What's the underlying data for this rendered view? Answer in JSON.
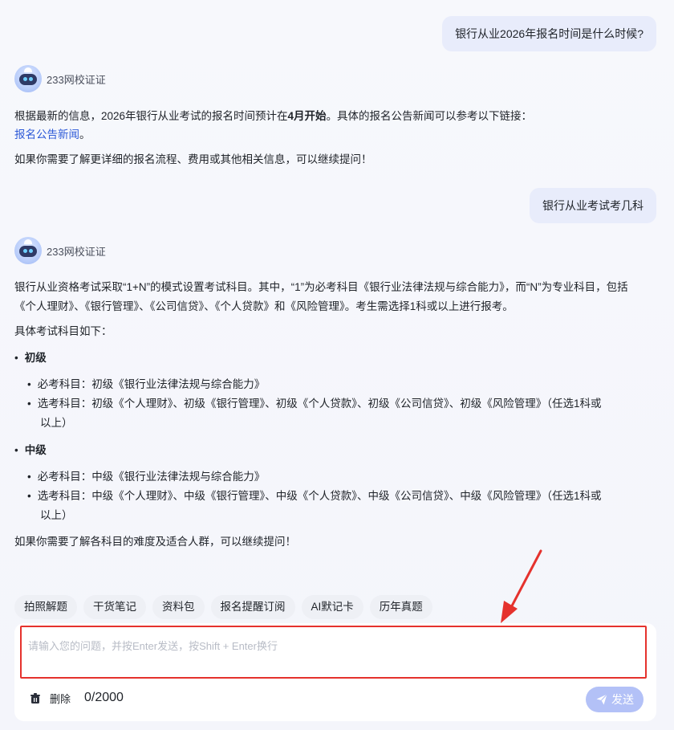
{
  "conversation": {
    "user_msg_1": "银行从业2026年报名时间是什么时候?",
    "user_msg_2": "银行从业考试考几科",
    "bot_name": "233网校证证",
    "answer_1": {
      "p1_prefix": "根据最新的信息，2026年银行从业考试的报名时间预计在",
      "p1_bold": "4月开始",
      "p1_suffix": "。具体的报名公告新闻可以参考以下链接：",
      "link_text": "报名公告新闻",
      "link_tail": "。",
      "p2": "如果你需要了解更详细的报名流程、费用或其他相关信息，可以继续提问！"
    },
    "answer_2": {
      "p1_line1": "银行从业资格考试采取“1+N”的模式设置考试科目。其中，“1”为必考科目《银行业法律法规与综合能力》，而“N”为专业科目，包括",
      "p1_line2": "《个人理财》、《银行管理》、《公司信贷》、《个人贷款》和《风险管理》。考生需选择1科或以上进行报考。",
      "intro": "具体考试科目如下：",
      "levels": [
        {
          "name": "初级",
          "required": "必考科目：初级《银行业法律法规与综合能力》",
          "optional_line1": "选考科目：初级《个人理财》、初级《银行管理》、初级《个人贷款》、初级《公司信贷》、初级《风险管理》（任选1科或",
          "optional_line2": "以上）"
        },
        {
          "name": "中级",
          "required": "必考科目：中级《银行业法律法规与综合能力》",
          "optional_line1": "选考科目：中级《个人理财》、中级《银行管理》、中级《个人贷款》、中级《公司信贷》、中级《风险管理》（任选1科或",
          "optional_line2": "以上）"
        }
      ],
      "closing": "如果你需要了解各科目的难度及适合人群，可以继续提问！"
    }
  },
  "quick_actions": [
    "拍照解题",
    "干货笔记",
    "资料包",
    "报名提醒订阅",
    "AI默记卡",
    "历年真题"
  ],
  "composer": {
    "placeholder": "请输入您的问题，并按Enter发送，按Shift + Enter换行",
    "value": "",
    "clear_label": "删除",
    "counter": "0/2000",
    "send_label": "发送"
  },
  "colors": {
    "accent": "#2e5bd8",
    "user_bubble": "#e8ecfb",
    "send_button": "#b3c1f7",
    "highlight_red": "#e5322d"
  }
}
